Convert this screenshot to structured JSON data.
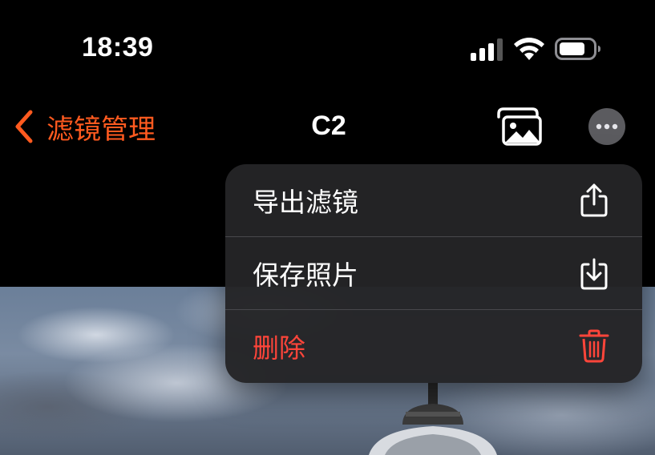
{
  "status_bar": {
    "time": "18:39",
    "icons": [
      "cellular-signal-icon",
      "wifi-icon",
      "battery-icon"
    ]
  },
  "nav_bar": {
    "back_label": "滤镜管理",
    "title": "C2",
    "right_icons": [
      "photos-icon",
      "more-icon"
    ]
  },
  "menu": {
    "items": [
      {
        "label": "导出滤镜",
        "icon": "share-icon",
        "destructive": false
      },
      {
        "label": "保存照片",
        "icon": "save-to-device-icon",
        "destructive": false
      },
      {
        "label": "删除",
        "icon": "trash-icon",
        "destructive": true
      }
    ]
  },
  "colors": {
    "accent": "#ff5a1f",
    "destructive": "#ff453a",
    "menu_background": "#242426",
    "background": "#000000"
  }
}
